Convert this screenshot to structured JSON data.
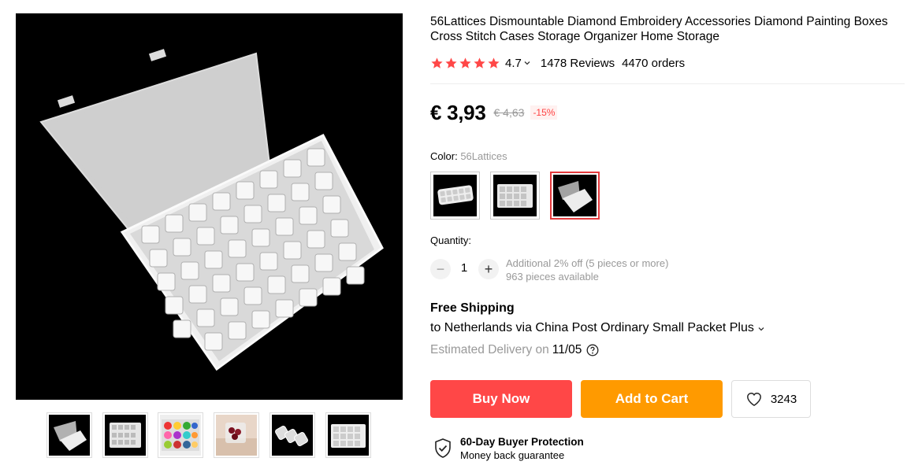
{
  "product": {
    "title": "56Lattices Dismountable Diamond Embroidery Accessories Diamond Painting Boxes Cross Stitch Cases Storage Organizer Home Storage",
    "rating": "4.7",
    "reviews": "1478 Reviews",
    "orders": "4470 orders",
    "price": "€ 3,93",
    "old_price": "€ 4,63",
    "discount": "-15%"
  },
  "color": {
    "label": "Color:",
    "selected": "56Lattices"
  },
  "quantity": {
    "label": "Quantity:",
    "minus": "−",
    "value": "1",
    "plus": "+",
    "note_line1": "Additional 2% off (5 pieces or more)",
    "note_line2": "963 pieces available"
  },
  "shipping": {
    "title": "Free Shipping",
    "detail": "to Netherlands via China Post Ordinary Small Packet Plus",
    "delivery_label": "Estimated Delivery on",
    "delivery_date": "11/05"
  },
  "actions": {
    "buy_now": "Buy Now",
    "add_to_cart": "Add to Cart",
    "wishlist_count": "3243"
  },
  "protection": {
    "title": "60-Day Buyer Protection",
    "subtitle": "Money back guarantee"
  },
  "colors": {
    "accent_red": "#ff4747",
    "accent_orange": "#ff9a00",
    "star": "#ff4747",
    "muted": "#999999"
  },
  "icons": [
    "star-icon",
    "chevron-down-icon",
    "help-icon",
    "heart-icon",
    "shield-check-icon"
  ]
}
